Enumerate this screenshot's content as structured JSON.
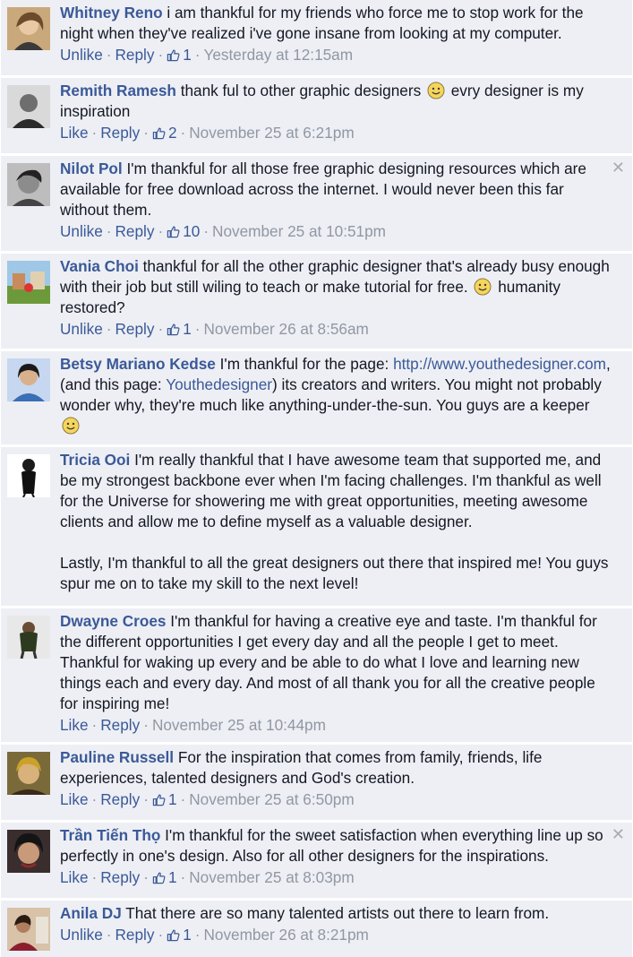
{
  "comments": [
    {
      "author": "Whitney Reno",
      "text": "i am thankful for my friends who force me to stop work for the night when they've realized i've gone insane from looking at my computer.",
      "like_label": "Unlike",
      "reply_label": "Reply",
      "likes": "1",
      "time": "Yesterday at 12:15am"
    },
    {
      "author": "Remith Ramesh",
      "text_a": "thank ful to other graphic designers",
      "text_b": "evry designer is my inspiration",
      "like_label": "Like",
      "reply_label": "Reply",
      "likes": "2",
      "time": "November 25 at 6:21pm"
    },
    {
      "author": "Nilot Pol",
      "text": "I'm thankful for all those free graphic designing resources which are available for free download across the internet. I would never been this far without them.",
      "like_label": "Unlike",
      "reply_label": "Reply",
      "likes": "10",
      "time": "November 25 at 10:51pm",
      "close": "✕"
    },
    {
      "author": "Vania Choi",
      "text_a": "thankful for all the other graphic designer that's already busy enough with their job but still wiling to teach or make tutorial for free.",
      "text_b": "humanity restored?",
      "like_label": "Unlike",
      "reply_label": "Reply",
      "likes": "1",
      "time": "November 26 at 8:56am"
    },
    {
      "author": "Betsy Mariano Kedse",
      "text_a": "I'm thankful for the page:",
      "link_a": "http://www.youthedesigner.com",
      "text_b": ", (and this page:",
      "link_b": "Youthedesigner",
      "text_c": ") its creators and writers. You might not probably wonder why, they're much like anything-under-the-sun. You guys are a keeper",
      "like_label": "",
      "reply_label": "",
      "likes": "",
      "time": ""
    },
    {
      "author": "Tricia Ooi",
      "text_a": "I'm really thankful that I have awesome team that supported me, and be my strongest backbone ever when I'm facing challenges. I'm thankful as well for the Universe for showering me with great opportunities, meeting awesome clients and allow me to define myself as a valuable designer.",
      "text_b": "Lastly, I'm thankful to all the great designers out there that inspired me! You guys spur me on to take my skill to the next level!"
    },
    {
      "author": "Dwayne Croes",
      "text": "I'm thankful for having a creative eye and taste. I'm thankful for the different opportunities I get every day and all the people I get to meet. Thankful for waking up every and be able to do what I love and learning new things each and every day. And most of all thank you for all the creative people for inspiring me!",
      "like_label": "Like",
      "reply_label": "Reply",
      "time": "November 25 at 10:44pm"
    },
    {
      "author": "Pauline Russell",
      "text": "For the inspiration that comes from family, friends, life experiences, talented designers and God's creation.",
      "like_label": "Like",
      "reply_label": "Reply",
      "likes": "1",
      "time": "November 25 at 6:50pm"
    },
    {
      "author": "Trần Tiến Thọ",
      "text": "I'm thankful for the sweet satisfaction when everything line up so perfectly in one's design. Also for all other designers for the inspirations.",
      "like_label": "Like",
      "reply_label": "Reply",
      "likes": "1",
      "time": "November 25 at 8:03pm",
      "close": "✕"
    },
    {
      "author": "Anila DJ",
      "text": "That there are so many talented artists out there to learn from.",
      "like_label": "Unlike",
      "reply_label": "Reply",
      "likes": "1",
      "time": "November 26 at 8:21pm"
    }
  ],
  "sep": "·"
}
